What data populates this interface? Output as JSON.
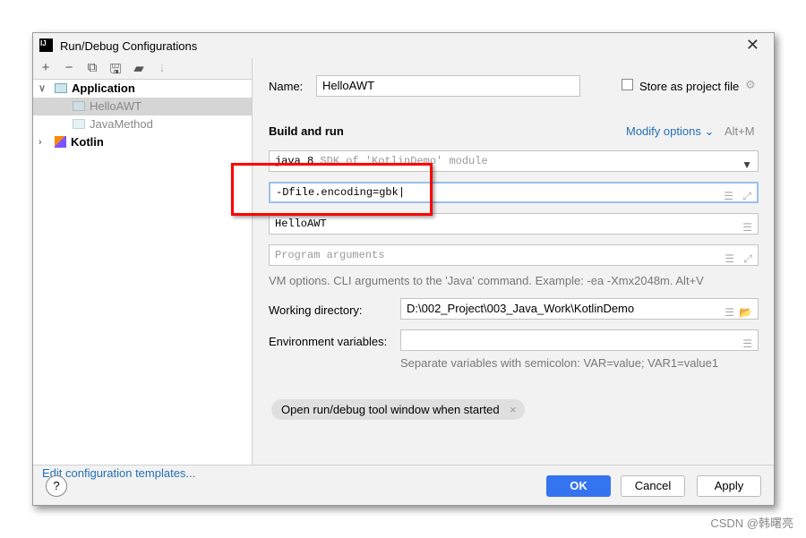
{
  "window": {
    "title": "Run/Debug Configurations"
  },
  "toolbar": [
    "add-icon",
    "remove-icon",
    "copy-icon",
    "save-icon",
    "new-folder-icon",
    "sort-icon"
  ],
  "tree": [
    {
      "label": "Application",
      "expanded": true,
      "children": [
        {
          "label": "HelloAWT",
          "selected": true
        },
        {
          "label": "JavaMethod"
        }
      ]
    },
    {
      "label": "Kotlin",
      "expanded": false
    }
  ],
  "edit_templates": "Edit configuration templates...",
  "name_label": "Name:",
  "name_value": "HelloAWT",
  "store_label": "Store as project file",
  "store_checked": false,
  "section": "Build and run",
  "modify_options": "Modify options",
  "modify_shortcut": "Alt+M",
  "sdk_bold": "java 8",
  "sdk_rest": "SDK of 'KotlinDemo' module",
  "vm_options": "-Dfile.encoding=gbk",
  "main_class": "HelloAWT",
  "program_args_placeholder": "Program arguments",
  "vm_hint": "VM options. CLI arguments to the 'Java' command. Example: -ea -Xmx2048m. Alt+V",
  "workdir_label": "Working directory:",
  "workdir_value": "D:\\002_Project\\003_Java_Work\\KotlinDemo",
  "env_label": "Environment variables:",
  "env_value": "",
  "env_hint": "Separate variables with semicolon: VAR=value; VAR1=value1",
  "chip": "Open run/debug tool window when started",
  "buttons": {
    "ok": "OK",
    "cancel": "Cancel",
    "apply": "Apply",
    "help": "?"
  },
  "accent": "#3574f0",
  "watermark": "CSDN @韩曙亮"
}
